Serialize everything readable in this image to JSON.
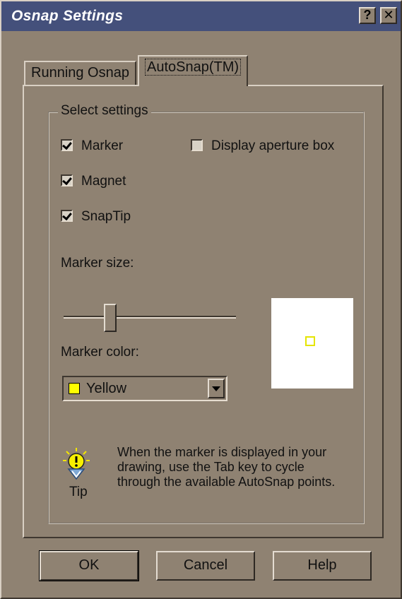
{
  "window": {
    "title": "Osnap Settings",
    "help_glyph": "?",
    "close_glyph": "✕"
  },
  "tabs": [
    {
      "label": "Running Osnap",
      "active": false
    },
    {
      "label": "AutoSnap(TM)",
      "active": true
    }
  ],
  "settings": {
    "group_label": "Select settings",
    "checkboxes": [
      {
        "label": "Marker",
        "checked": true
      },
      {
        "label": "Magnet",
        "checked": true
      },
      {
        "label": "SnapTip",
        "checked": true
      },
      {
        "label": "Display aperture box",
        "checked": false
      }
    ],
    "marker_size_label": "Marker size:",
    "marker_size_fraction": 0.25,
    "marker_color_label": "Marker color:",
    "marker_color_value": "Yellow",
    "marker_color_hex": "#ffff00",
    "preview_bg": "#ffffff"
  },
  "tip": {
    "icon": "lightbulb-icon",
    "label": "Tip",
    "lines": [
      "When the marker is displayed in your",
      "drawing, use the Tab key to cycle",
      "through the available AutoSnap points."
    ]
  },
  "buttons": {
    "ok": "OK",
    "cancel": "Cancel",
    "help": "Help"
  },
  "colors": {
    "titlebar": "#44507b",
    "dialog_bg": "#8f8272"
  }
}
